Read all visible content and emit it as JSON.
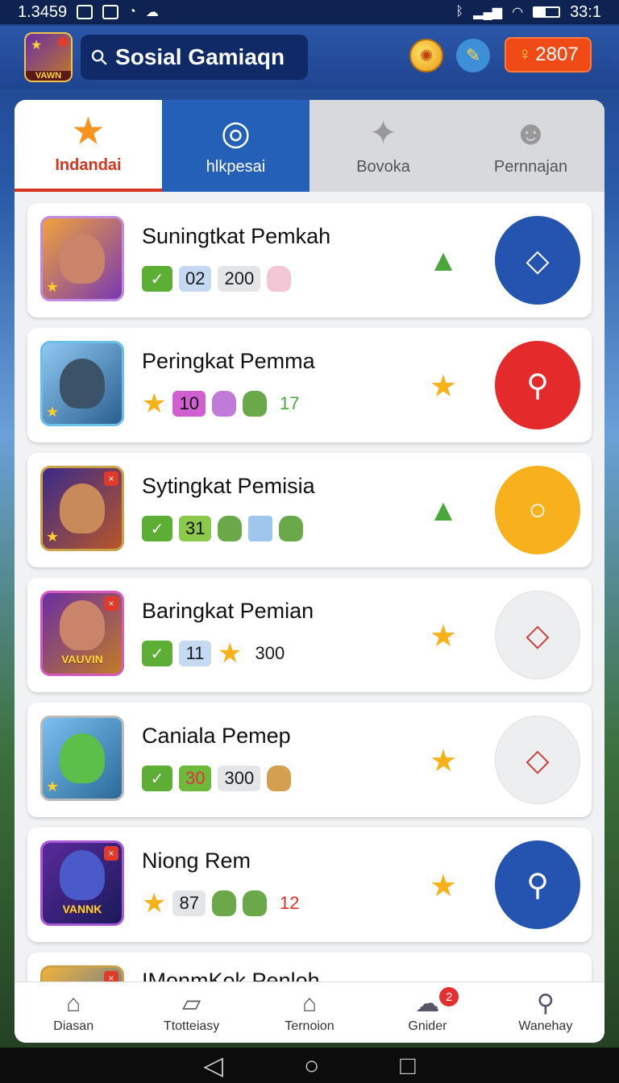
{
  "status_bar": {
    "time_left": "1.3459",
    "time_right": "33:1"
  },
  "header": {
    "logo_text": "VAWN",
    "search_text": "Sosial Gamiaqn",
    "badge_value": "2807",
    "coin_icon": "coin-icon",
    "edit_icon": "pencil-icon"
  },
  "tabs": [
    {
      "label": "Indandai",
      "icon": "star-icon"
    },
    {
      "label": "hlkpesai",
      "icon": "location-icon"
    },
    {
      "label": "Bovoka",
      "icon": "bell-icon"
    },
    {
      "label": "Pernnajan",
      "icon": "person-icon"
    }
  ],
  "rows": [
    {
      "title": "Suningtkat Pemkah",
      "chips": [
        "✓",
        "02",
        "200"
      ],
      "mid_icon": "thumb-up-icon",
      "action": "tag-icon",
      "action_color": "#2553b0"
    },
    {
      "title": "Peringkat Pemma",
      "chips": [
        "10",
        "17"
      ],
      "mid_icon": "star-icon",
      "action": "search-icon",
      "action_color": "#e42a2a"
    },
    {
      "title": "Sytingkat Pemisia",
      "chips": [
        "✓",
        "31"
      ],
      "mid_icon": "thumb-up-icon",
      "action": "circle-icon",
      "action_color": "#f8b01c"
    },
    {
      "title": "Baringkat Pemian",
      "chips": [
        "✓",
        "11",
        "300"
      ],
      "mid_icon": "star-icon",
      "action": "tag-icon",
      "action_color": "#eceef0"
    },
    {
      "title": "Caniala Pemep",
      "chips": [
        "✓",
        "30",
        "300"
      ],
      "mid_icon": "star-icon",
      "action": "tag-icon",
      "action_color": "#eceef0"
    },
    {
      "title": "Niong Rem",
      "chips": [
        "87",
        "12"
      ],
      "mid_icon": "star-icon",
      "action": "search-icon",
      "action_color": "#2553b0"
    },
    {
      "title": "IMonmKok Penloh"
    }
  ],
  "thumb_texts": {
    "row4": "VAUVIN",
    "row6": "VANNK"
  },
  "bottom_nav": [
    {
      "label": "Diasan",
      "icon": "home-icon"
    },
    {
      "label": "Ttotteiasy",
      "icon": "ticket-icon"
    },
    {
      "label": "Ternoion",
      "icon": "store-icon"
    },
    {
      "label": "Gnider",
      "icon": "chat-icon",
      "badge": "2"
    },
    {
      "label": "Wanehay",
      "icon": "user-icon"
    }
  ]
}
